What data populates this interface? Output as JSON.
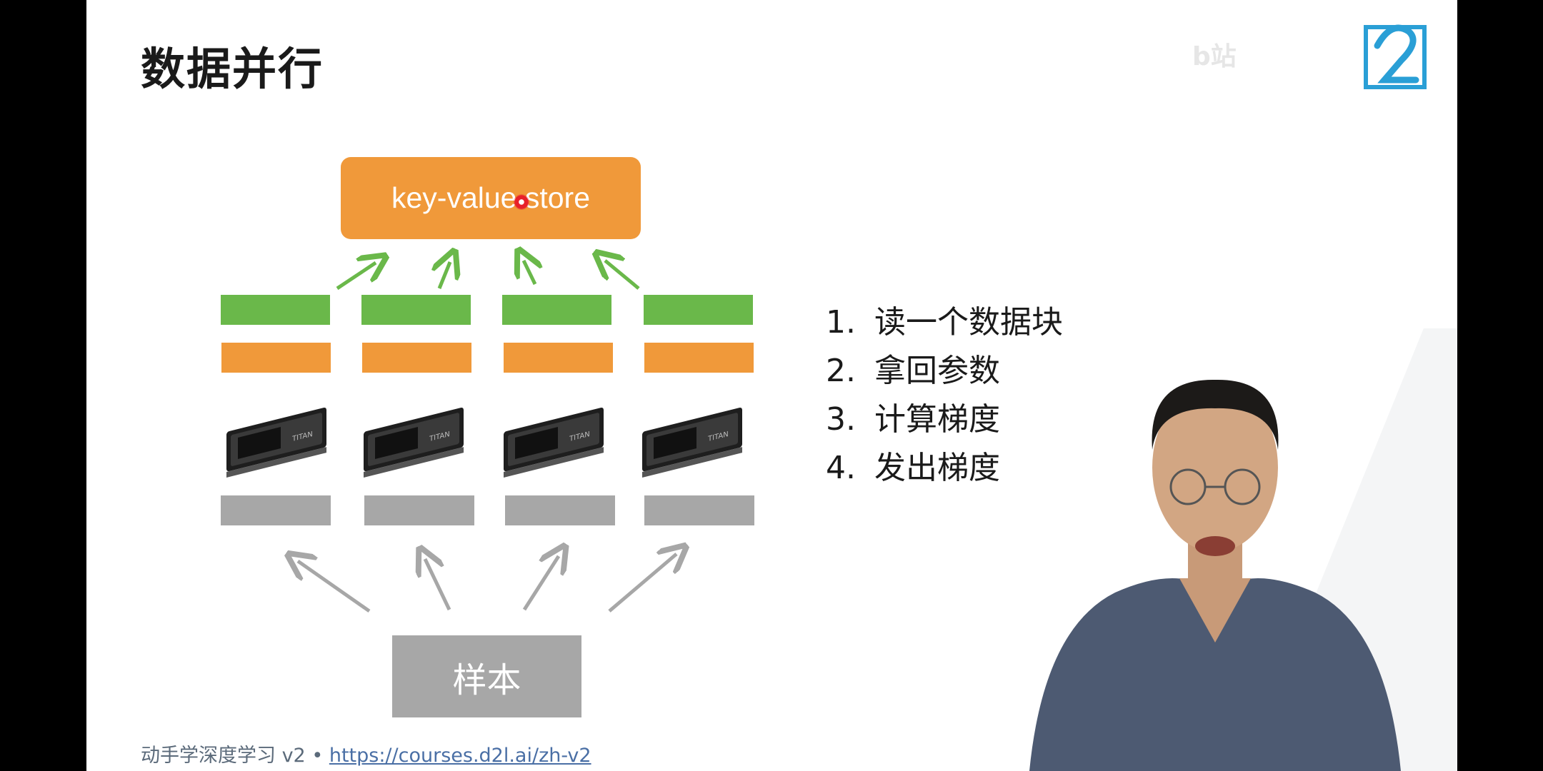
{
  "slide": {
    "title": "数据并行",
    "kv_store_label": "key-value store",
    "sample_label": "样本",
    "steps": [
      {
        "num": "1.",
        "text": "读一个数据块"
      },
      {
        "num": "2.",
        "text": "拿回参数"
      },
      {
        "num": "3.",
        "text": "计算梯度"
      },
      {
        "num": "4.",
        "text": "发出梯度"
      }
    ],
    "footer": {
      "course": "动手学深度学习 v2 • ",
      "link": "https://courses.d2l.ai/zh-v2"
    },
    "gpu_icons": [
      "gpu-card-icon",
      "gpu-card-icon",
      "gpu-card-icon",
      "gpu-card-icon"
    ],
    "colors": {
      "orange": "#f0993a",
      "green": "#6ab84a",
      "gray": "#a7a7a7",
      "logo_blue": "#2a9fd6"
    }
  }
}
